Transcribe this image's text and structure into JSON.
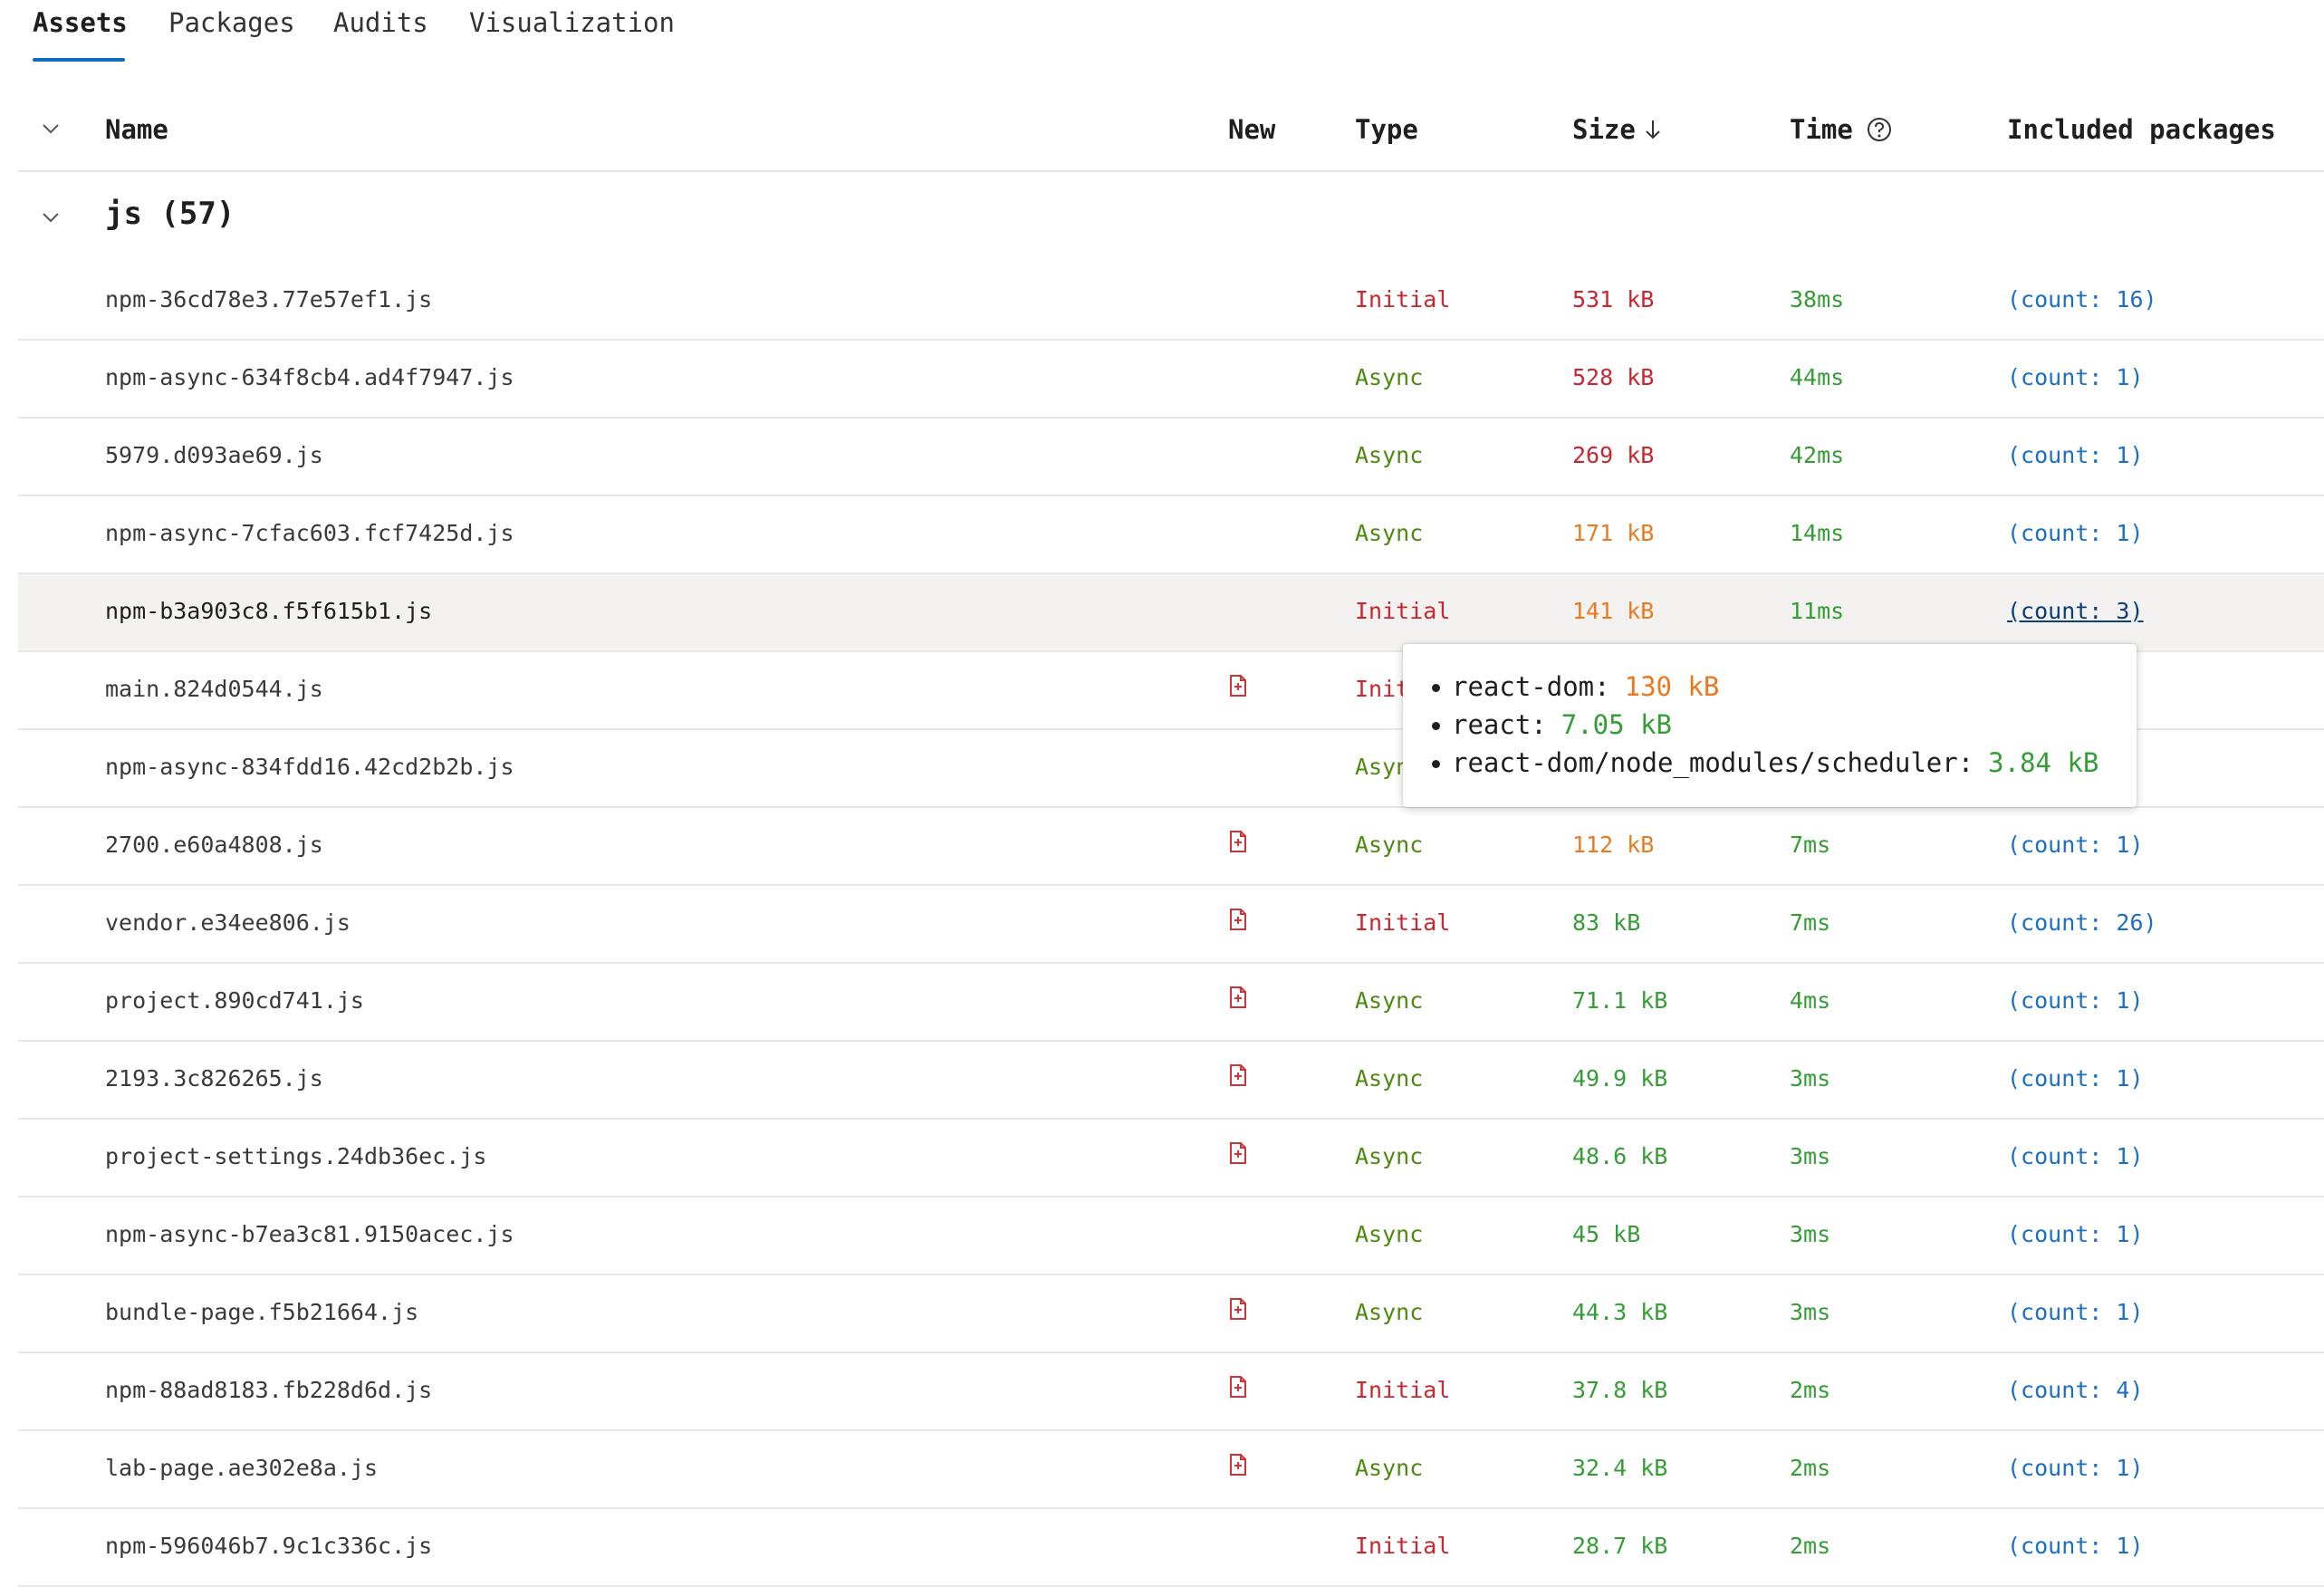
{
  "tabs": [
    {
      "label": "Assets",
      "active": true
    },
    {
      "label": "Packages",
      "active": false
    },
    {
      "label": "Audits",
      "active": false
    },
    {
      "label": "Visualization",
      "active": false
    }
  ],
  "table": {
    "columns": {
      "name": "Name",
      "new": "New",
      "type": "Type",
      "size": "Size",
      "time": "Time",
      "packages": "Included packages"
    },
    "sort_icon": "arrow-down-icon",
    "help_icon": "question-circle-icon",
    "group": {
      "label": "js (57)"
    },
    "rows": [
      {
        "name": "npm-36cd78e3.77e57ef1.js",
        "new": false,
        "type": "Initial",
        "size": "531 kB",
        "size_level": "red",
        "time": "38ms",
        "packages": "(count: 16)"
      },
      {
        "name": "npm-async-634f8cb4.ad4f7947.js",
        "new": false,
        "type": "Async",
        "size": "528 kB",
        "size_level": "red",
        "time": "44ms",
        "packages": "(count: 1)"
      },
      {
        "name": "5979.d093ae69.js",
        "new": false,
        "type": "Async",
        "size": "269 kB",
        "size_level": "red",
        "time": "42ms",
        "packages": "(count: 1)"
      },
      {
        "name": "npm-async-7cfac603.fcf7425d.js",
        "new": false,
        "type": "Async",
        "size": "171 kB",
        "size_level": "orange",
        "time": "14ms",
        "packages": "(count: 1)"
      },
      {
        "name": "npm-b3a903c8.f5f615b1.js",
        "new": false,
        "type": "Initial",
        "size": "141 kB",
        "size_level": "orange",
        "time": "11ms",
        "packages": "(count: 3)",
        "hover": true
      },
      {
        "name": "main.824d0544.js",
        "new": true,
        "type": "Initial",
        "size": "",
        "size_level": "orange",
        "time": "",
        "packages": ""
      },
      {
        "name": "npm-async-834fdd16.42cd2b2b.js",
        "new": false,
        "type": "Async",
        "size": "",
        "size_level": "orange",
        "time": "",
        "packages": ""
      },
      {
        "name": "2700.e60a4808.js",
        "new": true,
        "type": "Async",
        "size": "112 kB",
        "size_level": "orange",
        "time": "7ms",
        "packages": "(count: 1)"
      },
      {
        "name": "vendor.e34ee806.js",
        "new": true,
        "type": "Initial",
        "size": "83 kB",
        "size_level": "green",
        "time": "7ms",
        "packages": "(count: 26)"
      },
      {
        "name": "project.890cd741.js",
        "new": true,
        "type": "Async",
        "size": "71.1 kB",
        "size_level": "green",
        "time": "4ms",
        "packages": "(count: 1)"
      },
      {
        "name": "2193.3c826265.js",
        "new": true,
        "type": "Async",
        "size": "49.9 kB",
        "size_level": "green",
        "time": "3ms",
        "packages": "(count: 1)"
      },
      {
        "name": "project-settings.24db36ec.js",
        "new": true,
        "type": "Async",
        "size": "48.6 kB",
        "size_level": "green",
        "time": "3ms",
        "packages": "(count: 1)"
      },
      {
        "name": "npm-async-b7ea3c81.9150acec.js",
        "new": false,
        "type": "Async",
        "size": "45 kB",
        "size_level": "green",
        "time": "3ms",
        "packages": "(count: 1)"
      },
      {
        "name": "bundle-page.f5b21664.js",
        "new": true,
        "type": "Async",
        "size": "44.3 kB",
        "size_level": "green",
        "time": "3ms",
        "packages": "(count: 1)"
      },
      {
        "name": "npm-88ad8183.fb228d6d.js",
        "new": true,
        "type": "Initial",
        "size": "37.8 kB",
        "size_level": "green",
        "time": "2ms",
        "packages": "(count: 4)"
      },
      {
        "name": "lab-page.ae302e8a.js",
        "new": true,
        "type": "Async",
        "size": "32.4 kB",
        "size_level": "green",
        "time": "2ms",
        "packages": "(count: 1)"
      },
      {
        "name": "npm-596046b7.9c1c336c.js",
        "new": false,
        "type": "Initial",
        "size": "28.7 kB",
        "size_level": "green",
        "time": "2ms",
        "packages": "(count: 1)"
      }
    ]
  },
  "tooltip": {
    "items": [
      {
        "name": "react-dom:",
        "size": "130 kB",
        "size_level": "orange"
      },
      {
        "name": "react:",
        "size": "7.05 kB",
        "size_level": "green"
      },
      {
        "name": "react-dom/node_modules/scheduler:",
        "size": "3.84 kB",
        "size_level": "green"
      }
    ]
  },
  "colors": {
    "accent": "#0f6cbd",
    "initial": "#c8272f",
    "async": "#4f8a10",
    "size_red": "#c8272f",
    "size_orange": "#e97a1f",
    "size_green": "#359d35",
    "link": "#1c6fc7",
    "new_icon": "#d13438"
  }
}
